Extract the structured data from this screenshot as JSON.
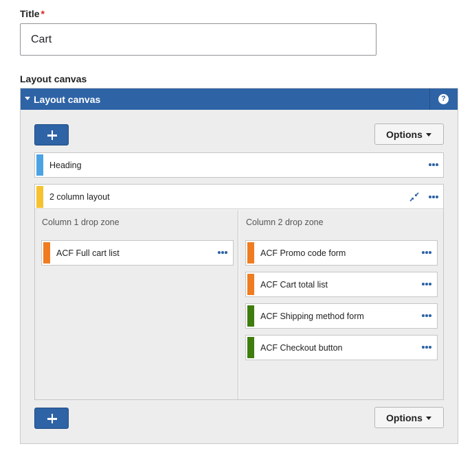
{
  "title_field": {
    "label": "Title",
    "required_marker": "*",
    "value": "Cart"
  },
  "layout_canvas": {
    "field_label": "Layout canvas",
    "panel_title": "Layout canvas",
    "help_icon": "question-circle-icon",
    "options_label": "Options",
    "add_button_icon": "plus-icon",
    "items": [
      {
        "label": "Heading",
        "color": "#4ba3e3"
      },
      {
        "label": "2 column layout",
        "color": "#f6c230",
        "collapse_icon": "collapse-arrows-icon",
        "columns": [
          {
            "label": "Column 1 drop zone",
            "items": [
              {
                "label": "ACF Full cart list",
                "color": "#f07c21"
              }
            ]
          },
          {
            "label": "Column 2 drop zone",
            "items": [
              {
                "label": "ACF Promo code form",
                "color": "#f07c21"
              },
              {
                "label": "ACF Cart total list",
                "color": "#f07c21"
              },
              {
                "label": "ACF Shipping method form",
                "color": "#3f7d0e"
              },
              {
                "label": "ACF Checkout button",
                "color": "#3f7d0e"
              }
            ]
          }
        ]
      }
    ]
  },
  "colors": {
    "accent": "#2e63a6",
    "required": "#dc2323"
  }
}
